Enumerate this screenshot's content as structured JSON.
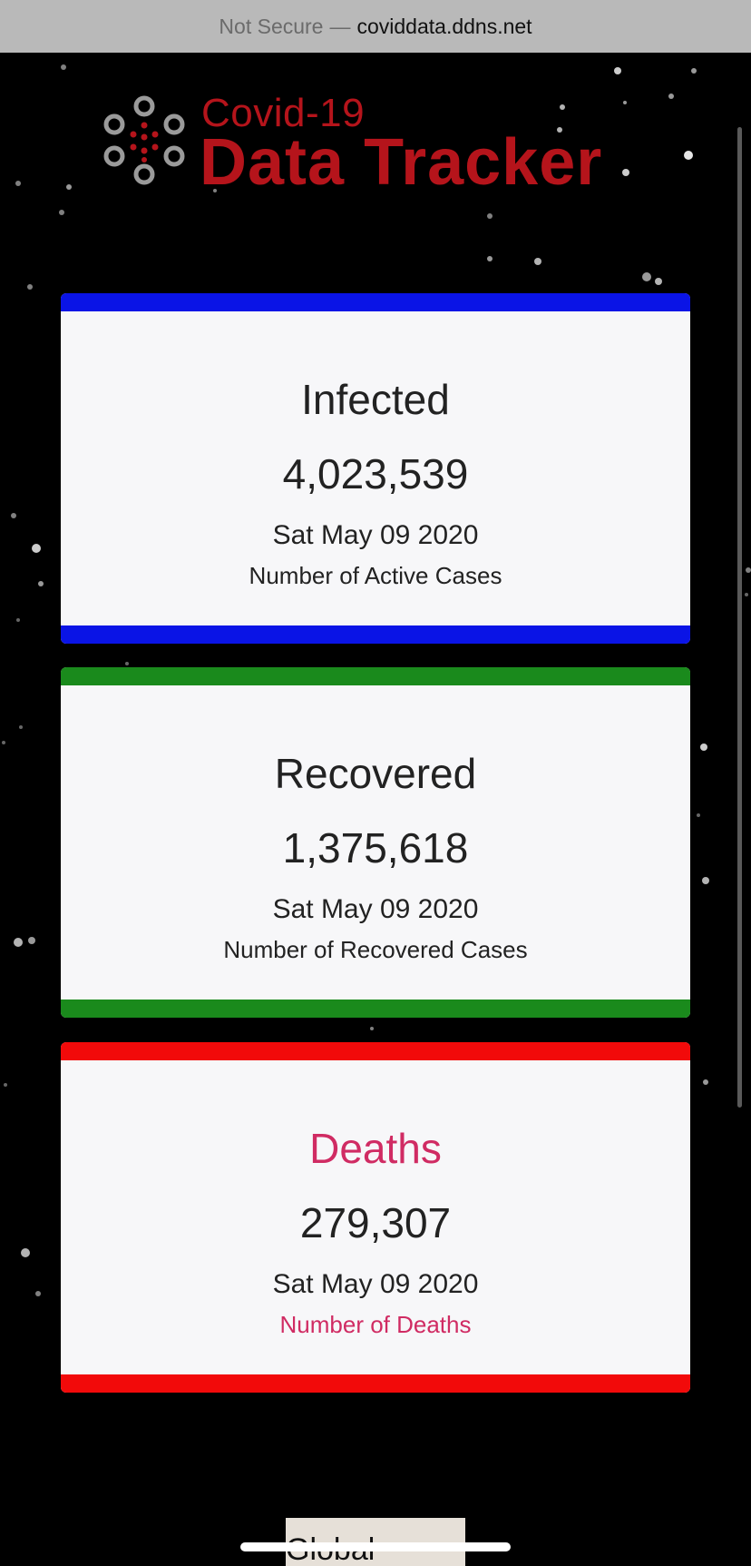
{
  "browser": {
    "security_label": "Not Secure",
    "separator": "—",
    "domain": "coviddata.ddns.net"
  },
  "logo": {
    "line1": "Covid-19",
    "line2": "Data Tracker"
  },
  "cards": [
    {
      "title": "Infected",
      "count": "4,023,539",
      "date": "Sat May 09 2020",
      "description": "Number of Active Cases",
      "band_color": "#0a14e6"
    },
    {
      "title": "Recovered",
      "count": "1,375,618",
      "date": "Sat May 09 2020",
      "description": "Number of Recovered Cases",
      "band_color": "#1a8a1c"
    },
    {
      "title": "Deaths",
      "count": "279,307",
      "date": "Sat May 09 2020",
      "description": "Number of Deaths",
      "band_color": "#f20a0a",
      "accent_color": "#d02b63"
    }
  ],
  "bottom_tab": {
    "label": "Global"
  },
  "colors": {
    "background": "#000000",
    "logo_red": "#b5141b",
    "card_background": "#f7f7f9"
  }
}
